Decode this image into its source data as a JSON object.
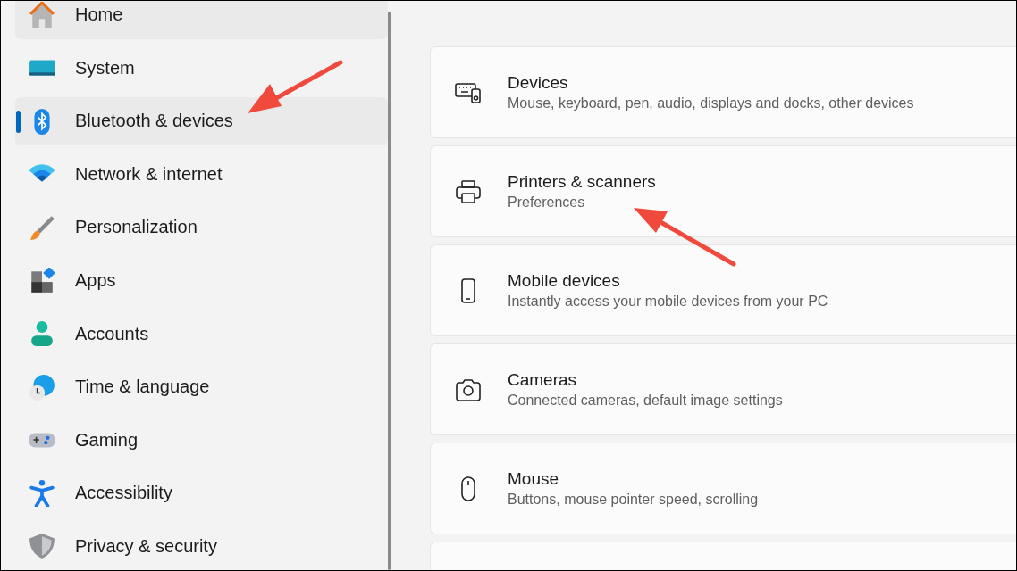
{
  "sidebar": {
    "items": [
      {
        "label": "Home",
        "kind": "home",
        "selected": false
      },
      {
        "label": "System",
        "kind": "system",
        "selected": false
      },
      {
        "label": "Bluetooth & devices",
        "kind": "bluetooth",
        "selected": true
      },
      {
        "label": "Network & internet",
        "kind": "network",
        "selected": false
      },
      {
        "label": "Personalization",
        "kind": "brush",
        "selected": false
      },
      {
        "label": "Apps",
        "kind": "apps",
        "selected": false
      },
      {
        "label": "Accounts",
        "kind": "person",
        "selected": false
      },
      {
        "label": "Time & language",
        "kind": "time",
        "selected": false
      },
      {
        "label": "Gaming",
        "kind": "gamepad",
        "selected": false
      },
      {
        "label": "Accessibility",
        "kind": "accessibility",
        "selected": false
      },
      {
        "label": "Privacy & security",
        "kind": "shield",
        "selected": false
      }
    ]
  },
  "cards": [
    {
      "title": "Devices",
      "subtitle": "Mouse, keyboard, pen, audio, displays and docks, other devices",
      "kind": "devices"
    },
    {
      "title": "Printers & scanners",
      "subtitle": "Preferences",
      "kind": "printer"
    },
    {
      "title": "Mobile devices",
      "subtitle": "Instantly access your mobile devices from your PC",
      "kind": "phone"
    },
    {
      "title": "Cameras",
      "subtitle": "Connected cameras, default image settings",
      "kind": "camera"
    },
    {
      "title": "Mouse",
      "subtitle": "Buttons, mouse pointer speed, scrolling",
      "kind": "mouse"
    },
    {
      "kind": "partial"
    }
  ]
}
